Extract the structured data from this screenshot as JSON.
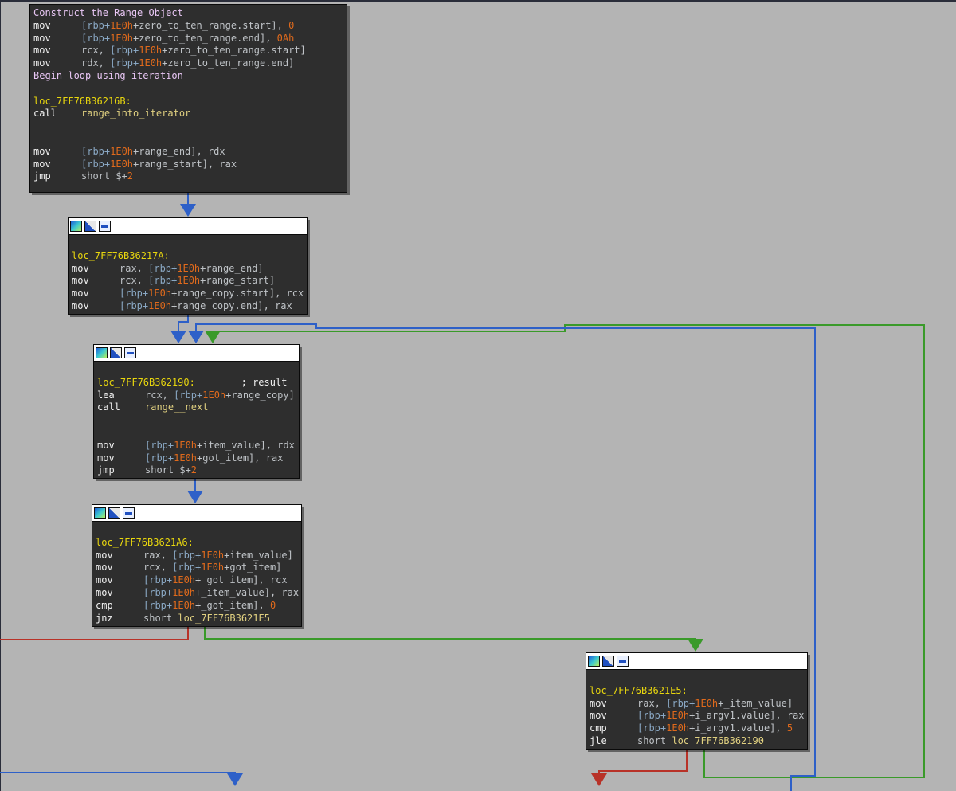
{
  "colors": {
    "background": "#b4b4b4",
    "node_bg": "#2e2e2e",
    "edge_blue": "#2e60c8",
    "edge_green": "#3a9a2a",
    "edge_red": "#b83228"
  },
  "node_icons": [
    "graph-colors-icon",
    "edit-color-icon",
    "group-nodes-icon"
  ],
  "nodes": [
    {
      "id": "n1",
      "lines": [
        [
          [
            "cm",
            "Construct the Range Object"
          ]
        ],
        [
          [
            "mn",
            "mov"
          ],
          [
            "rbp",
            "[rbp+"
          ],
          [
            "off",
            "1E0h"
          ],
          [
            "op",
            "+zero_to_ten_range.start], "
          ],
          [
            "num",
            "0"
          ]
        ],
        [
          [
            "mn",
            "mov"
          ],
          [
            "rbp",
            "[rbp+"
          ],
          [
            "off",
            "1E0h"
          ],
          [
            "op",
            "+zero_to_ten_range.end], "
          ],
          [
            "num",
            "0Ah"
          ]
        ],
        [
          [
            "mn",
            "mov"
          ],
          [
            "op",
            "rcx, "
          ],
          [
            "rbp",
            "[rbp+"
          ],
          [
            "off",
            "1E0h"
          ],
          [
            "op",
            "+zero_to_ten_range.start]"
          ]
        ],
        [
          [
            "mn",
            "mov"
          ],
          [
            "op",
            "rdx, "
          ],
          [
            "rbp",
            "[rbp+"
          ],
          [
            "off",
            "1E0h"
          ],
          [
            "op",
            "+zero_to_ten_range.end]"
          ]
        ],
        [
          [
            "cm",
            "Begin loop using iteration"
          ]
        ],
        [],
        [
          [
            "lbl",
            "loc_7FF76B36216B:"
          ]
        ],
        [
          [
            "mn",
            "call"
          ],
          [
            "fn",
            "range_into_iterator"
          ]
        ],
        [],
        [],
        [
          [
            "mn",
            "mov"
          ],
          [
            "rbp",
            "[rbp+"
          ],
          [
            "off",
            "1E0h"
          ],
          [
            "op",
            "+range_end], rdx"
          ]
        ],
        [
          [
            "mn",
            "mov"
          ],
          [
            "rbp",
            "[rbp+"
          ],
          [
            "off",
            "1E0h"
          ],
          [
            "op",
            "+range_start], rax"
          ]
        ],
        [
          [
            "mn",
            "jmp"
          ],
          [
            "op",
            "short $+"
          ],
          [
            "num",
            "2"
          ]
        ]
      ]
    },
    {
      "id": "n2",
      "lines": [
        [],
        [
          [
            "lbl",
            "loc_7FF76B36217A:"
          ]
        ],
        [
          [
            "mn",
            "mov"
          ],
          [
            "op",
            "rax, "
          ],
          [
            "rbp",
            "[rbp+"
          ],
          [
            "off",
            "1E0h"
          ],
          [
            "op",
            "+range_end]"
          ]
        ],
        [
          [
            "mn",
            "mov"
          ],
          [
            "op",
            "rcx, "
          ],
          [
            "rbp",
            "[rbp+"
          ],
          [
            "off",
            "1E0h"
          ],
          [
            "op",
            "+range_start]"
          ]
        ],
        [
          [
            "mn",
            "mov"
          ],
          [
            "rbp",
            "[rbp+"
          ],
          [
            "off",
            "1E0h"
          ],
          [
            "op",
            "+range_copy.start], rcx"
          ]
        ],
        [
          [
            "mn",
            "mov"
          ],
          [
            "rbp",
            "[rbp+"
          ],
          [
            "off",
            "1E0h"
          ],
          [
            "op",
            "+range_copy.end], rax"
          ]
        ]
      ]
    },
    {
      "id": "n3",
      "lines": [
        [],
        [
          [
            "lbl",
            "loc_7FF76B362190:"
          ],
          [
            "res",
            "        ; result"
          ]
        ],
        [
          [
            "mn",
            "lea"
          ],
          [
            "op",
            "rcx, "
          ],
          [
            "rbp",
            "[rbp+"
          ],
          [
            "off",
            "1E0h"
          ],
          [
            "op",
            "+range_copy]"
          ]
        ],
        [
          [
            "mn",
            "call"
          ],
          [
            "fn",
            "range__next"
          ]
        ],
        [],
        [],
        [
          [
            "mn",
            "mov"
          ],
          [
            "rbp",
            "[rbp+"
          ],
          [
            "off",
            "1E0h"
          ],
          [
            "op",
            "+item_value], rdx"
          ]
        ],
        [
          [
            "mn",
            "mov"
          ],
          [
            "rbp",
            "[rbp+"
          ],
          [
            "off",
            "1E0h"
          ],
          [
            "op",
            "+got_item], rax"
          ]
        ],
        [
          [
            "mn",
            "jmp"
          ],
          [
            "op",
            "short $+"
          ],
          [
            "num",
            "2"
          ]
        ]
      ]
    },
    {
      "id": "n4",
      "lines": [
        [],
        [
          [
            "lbl",
            "loc_7FF76B3621A6:"
          ]
        ],
        [
          [
            "mn",
            "mov"
          ],
          [
            "op",
            "rax, "
          ],
          [
            "rbp",
            "[rbp+"
          ],
          [
            "off",
            "1E0h"
          ],
          [
            "op",
            "+item_value]"
          ]
        ],
        [
          [
            "mn",
            "mov"
          ],
          [
            "op",
            "rcx, "
          ],
          [
            "rbp",
            "[rbp+"
          ],
          [
            "off",
            "1E0h"
          ],
          [
            "op",
            "+got_item]"
          ]
        ],
        [
          [
            "mn",
            "mov"
          ],
          [
            "rbp",
            "[rbp+"
          ],
          [
            "off",
            "1E0h"
          ],
          [
            "op",
            "+_got_item], rcx"
          ]
        ],
        [
          [
            "mn",
            "mov"
          ],
          [
            "rbp",
            "[rbp+"
          ],
          [
            "off",
            "1E0h"
          ],
          [
            "op",
            "+_item_value], rax"
          ]
        ],
        [
          [
            "mn",
            "cmp"
          ],
          [
            "rbp",
            "[rbp+"
          ],
          [
            "off",
            "1E0h"
          ],
          [
            "op",
            "+_got_item], "
          ],
          [
            "num",
            "0"
          ]
        ],
        [
          [
            "mn",
            "jnz"
          ],
          [
            "op",
            "short "
          ],
          [
            "fn",
            "loc_7FF76B3621E5"
          ]
        ]
      ]
    },
    {
      "id": "n5",
      "lines": [
        [],
        [
          [
            "lbl",
            "loc_7FF76B3621E5:"
          ]
        ],
        [
          [
            "mn",
            "mov"
          ],
          [
            "op",
            "rax, "
          ],
          [
            "rbp",
            "[rbp+"
          ],
          [
            "off",
            "1E0h"
          ],
          [
            "op",
            "+_item_value]"
          ]
        ],
        [
          [
            "mn",
            "mov"
          ],
          [
            "rbp",
            "[rbp+"
          ],
          [
            "off",
            "1E0h"
          ],
          [
            "op",
            "+i_argv1.value], rax"
          ]
        ],
        [
          [
            "mn",
            "cmp"
          ],
          [
            "rbp",
            "[rbp+"
          ],
          [
            "off",
            "1E0h"
          ],
          [
            "op",
            "+i_argv1.value], "
          ],
          [
            "num",
            "5"
          ]
        ],
        [
          [
            "mn",
            "jle"
          ],
          [
            "op",
            "short "
          ],
          [
            "fn",
            "loc_7FF76B362190"
          ]
        ]
      ]
    }
  ]
}
